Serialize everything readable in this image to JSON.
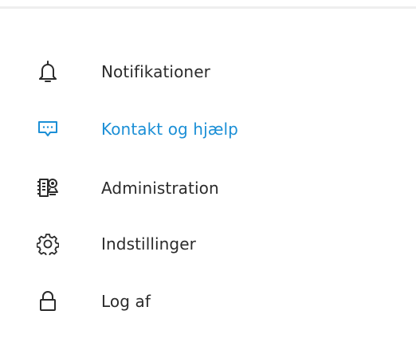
{
  "menu": {
    "items": [
      {
        "label": "Notifikationer",
        "icon": "bell-icon",
        "active": false
      },
      {
        "label": "Kontakt og hjælp",
        "icon": "chat-bubble-icon",
        "active": true
      },
      {
        "label": "Administration",
        "icon": "admin-id-card-icon",
        "active": false
      },
      {
        "label": "Indstillinger",
        "icon": "gear-icon",
        "active": false
      },
      {
        "label": "Log af",
        "icon": "lock-icon",
        "active": false
      }
    ]
  },
  "colors": {
    "text": "#2b2b2b",
    "active": "#1b8fd6",
    "divider": "#eeeeee",
    "background": "#ffffff"
  }
}
